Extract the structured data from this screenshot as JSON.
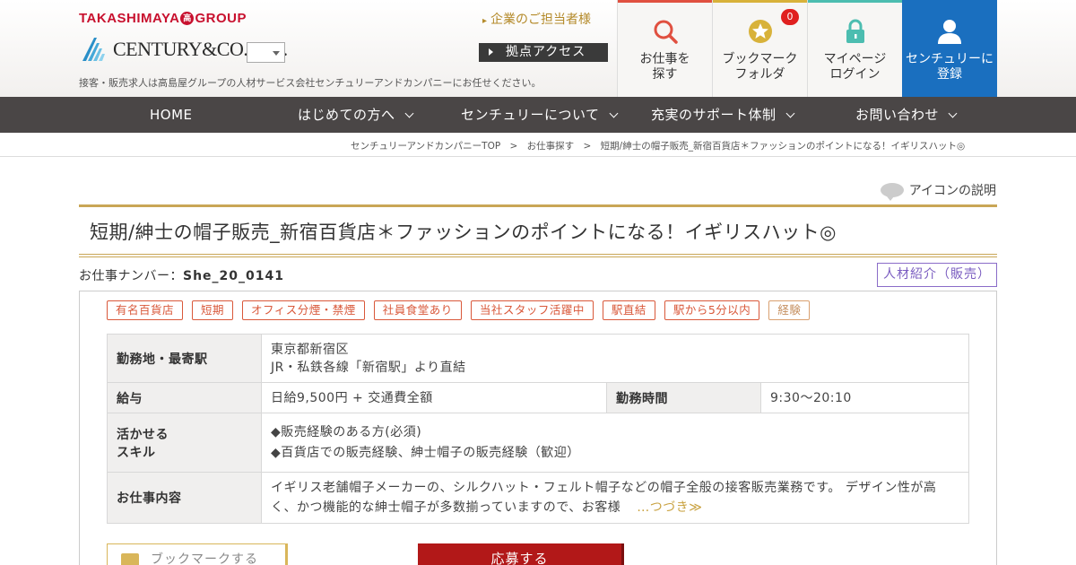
{
  "header": {
    "group_logo_left": "TAKASHIMAYA",
    "group_logo_seal": "高",
    "group_logo_right": "GROUP",
    "company_logo": "CENTURY&CO.LTD.",
    "tagline": "接客・販売求人は高島屋グループの人材サービス会社センチュリーアンドカンパニーにお任せください。",
    "corp_link": "企業のご担当者様",
    "access_button": "拠点アクセス",
    "tiles": {
      "search": {
        "line1": "お仕事を",
        "line2": "探す"
      },
      "bookmark": {
        "line1": "ブックマーク",
        "line2": "フォルダ",
        "count": "0"
      },
      "mypage": {
        "line1": "マイページ",
        "line2": "ログイン"
      },
      "register": {
        "line1": "センチュリーに",
        "line2": "登録"
      }
    },
    "colors": {
      "search": "#e05040",
      "bookmark": "#d8b23a",
      "mypage": "#4cbdb0",
      "register": "#1a6fbf"
    }
  },
  "gnav": {
    "home": "HOME",
    "first_time": "はじめての方へ",
    "about": "センチュリーについて",
    "support": "充実のサポート体制",
    "contact": "お問い合わせ"
  },
  "breadcrumb": {
    "top": "センチュリーアンドカンパニーTOP",
    "sep": ">",
    "search": "お仕事探す",
    "current": "短期/紳士の帽子販売_新宿百貨店＊ファッションのポイントになる！イギリスハット◎"
  },
  "icon_help": "アイコンの説明",
  "job": {
    "title": "短期/紳士の帽子販売_新宿百貨店＊ファッションのポイントになる！イギリスハット◎",
    "number_label": "お仕事ナンバー：",
    "number": "She_20_0141",
    "type": "人材紹介（販売）",
    "tags": [
      "有名百貨店",
      "短期",
      "オフィス分煙・禁煙",
      "社員食堂あり",
      "当社スタッフ活躍中",
      "駅直結",
      "駅から5分以内",
      "経験"
    ],
    "location_label": "勤務地・最寄駅",
    "location_line1": "東京都新宿区",
    "location_line2": "JR・私鉄各線「新宿駅」より直結",
    "salary_label": "給与",
    "salary": "日給9,500円 + 交通費全額",
    "hours_label": "勤務時間",
    "hours": "9:30～20:10",
    "skills_label_line1": "活かせる",
    "skills_label_line2": "スキル",
    "skills_line1": "◆販売経験のある方(必須)",
    "skills_line2": "◆百貨店での販売経験、紳士帽子の販売経験（歓迎）",
    "description_label": "お仕事内容",
    "description": "イギリス老舗帽子メーカーの、シルクハット・フェルト帽子などの帽子全般の接客販売業務です。 デザイン性が高く、かつ機能的な紳士帽子が多数揃っていますので、お客様",
    "more": "…つづき≫"
  },
  "actions": {
    "bookmark": "ブックマークする",
    "apply": "応募する"
  }
}
